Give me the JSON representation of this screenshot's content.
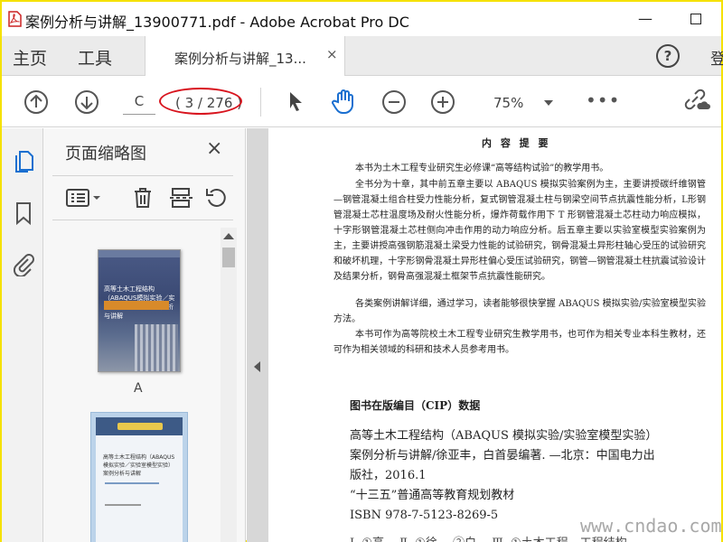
{
  "window": {
    "title": "案例分析与讲解_13900771.pdf - Adobe Acrobat Pro DC",
    "minimize_glyph": "—"
  },
  "tabs": {
    "home": "主页",
    "tools": "工具",
    "document": "案例分析与讲解_13...",
    "document_close": "×",
    "help": "?",
    "signin_partial": "登"
  },
  "toolbar": {
    "page_current": "C",
    "page_total": "( 3 / 276 )",
    "zoom": "75%",
    "more": "•••",
    "highlight_color": "#d8141e"
  },
  "thumbnails_panel": {
    "title": "页面缩略图",
    "close": "×",
    "thumbnails": [
      {
        "label": "A",
        "cover_title": "高等土木工程结构（ABAQUS模拟实验／实验室模型实验）案例分析与讲解"
      },
      {
        "label": "",
        "cover_title": "高等土木工程结构（ABAQUS模拟实验／实验室模型实验）案例分析与讲解"
      }
    ]
  },
  "page": {
    "heading": "内 容 提 要",
    "paragraphs": [
      "本书为土木工程专业研究生必修课“高等结构试验”的教学用书。",
      "全书分为十章，其中前五章主要以 ABAQUS 模拟实验案例为主，主要讲授碳纤维钢管—钢管混凝土组合柱受力性能分析，复式钢管混凝土柱与钢梁空间节点抗震性能分析，L形钢管混凝土芯柱温度场及耐火性能分析，爆炸荷载作用下 T 形钢管混凝土芯柱动力响应模拟，十字形钢管混凝土芯柱侧向冲击作用的动力响应分析。后五章主要以实验室模型实验案例为主，主要讲授高强钢筋混凝土梁受力性能的试验研究，钢骨混凝土异形柱轴心受压的试验研究和破坏机理，十字形钢骨混凝土异形柱偏心受压试验研究，钢管—钢管混凝土柱抗震试验设计及结果分析，钢骨高强混凝土框架节点抗震性能研究。",
      "各类案例讲解详细，通过学习，读者能够很快掌握 ABAQUS 模拟实验/实验室模型实验方法。",
      "本书可作为高等院校土木工程专业研究生教学用书，也可作为相关专业本科生教材，还可作为相关领域的科研和技术人员参考用书。"
    ],
    "cip_title": "图书在版编目（CIP）数据",
    "cip_lines": [
      "高等土木工程结构（ABAQUS 模拟实验/实验室模型实验）",
      "案例分析与讲解/徐亚丰，白首晏编著. —北京：中国电力出",
      "版社，2016.1",
      "“十三五”普通高等教育规划教材",
      "ISBN 978-7-5123-8269-5"
    ],
    "cip_cut_line": "Ⅰ. ①高… Ⅱ. ①徐… ②白… Ⅲ. ①土木工程—工程结构"
  },
  "watermark": "www.cndao.com"
}
